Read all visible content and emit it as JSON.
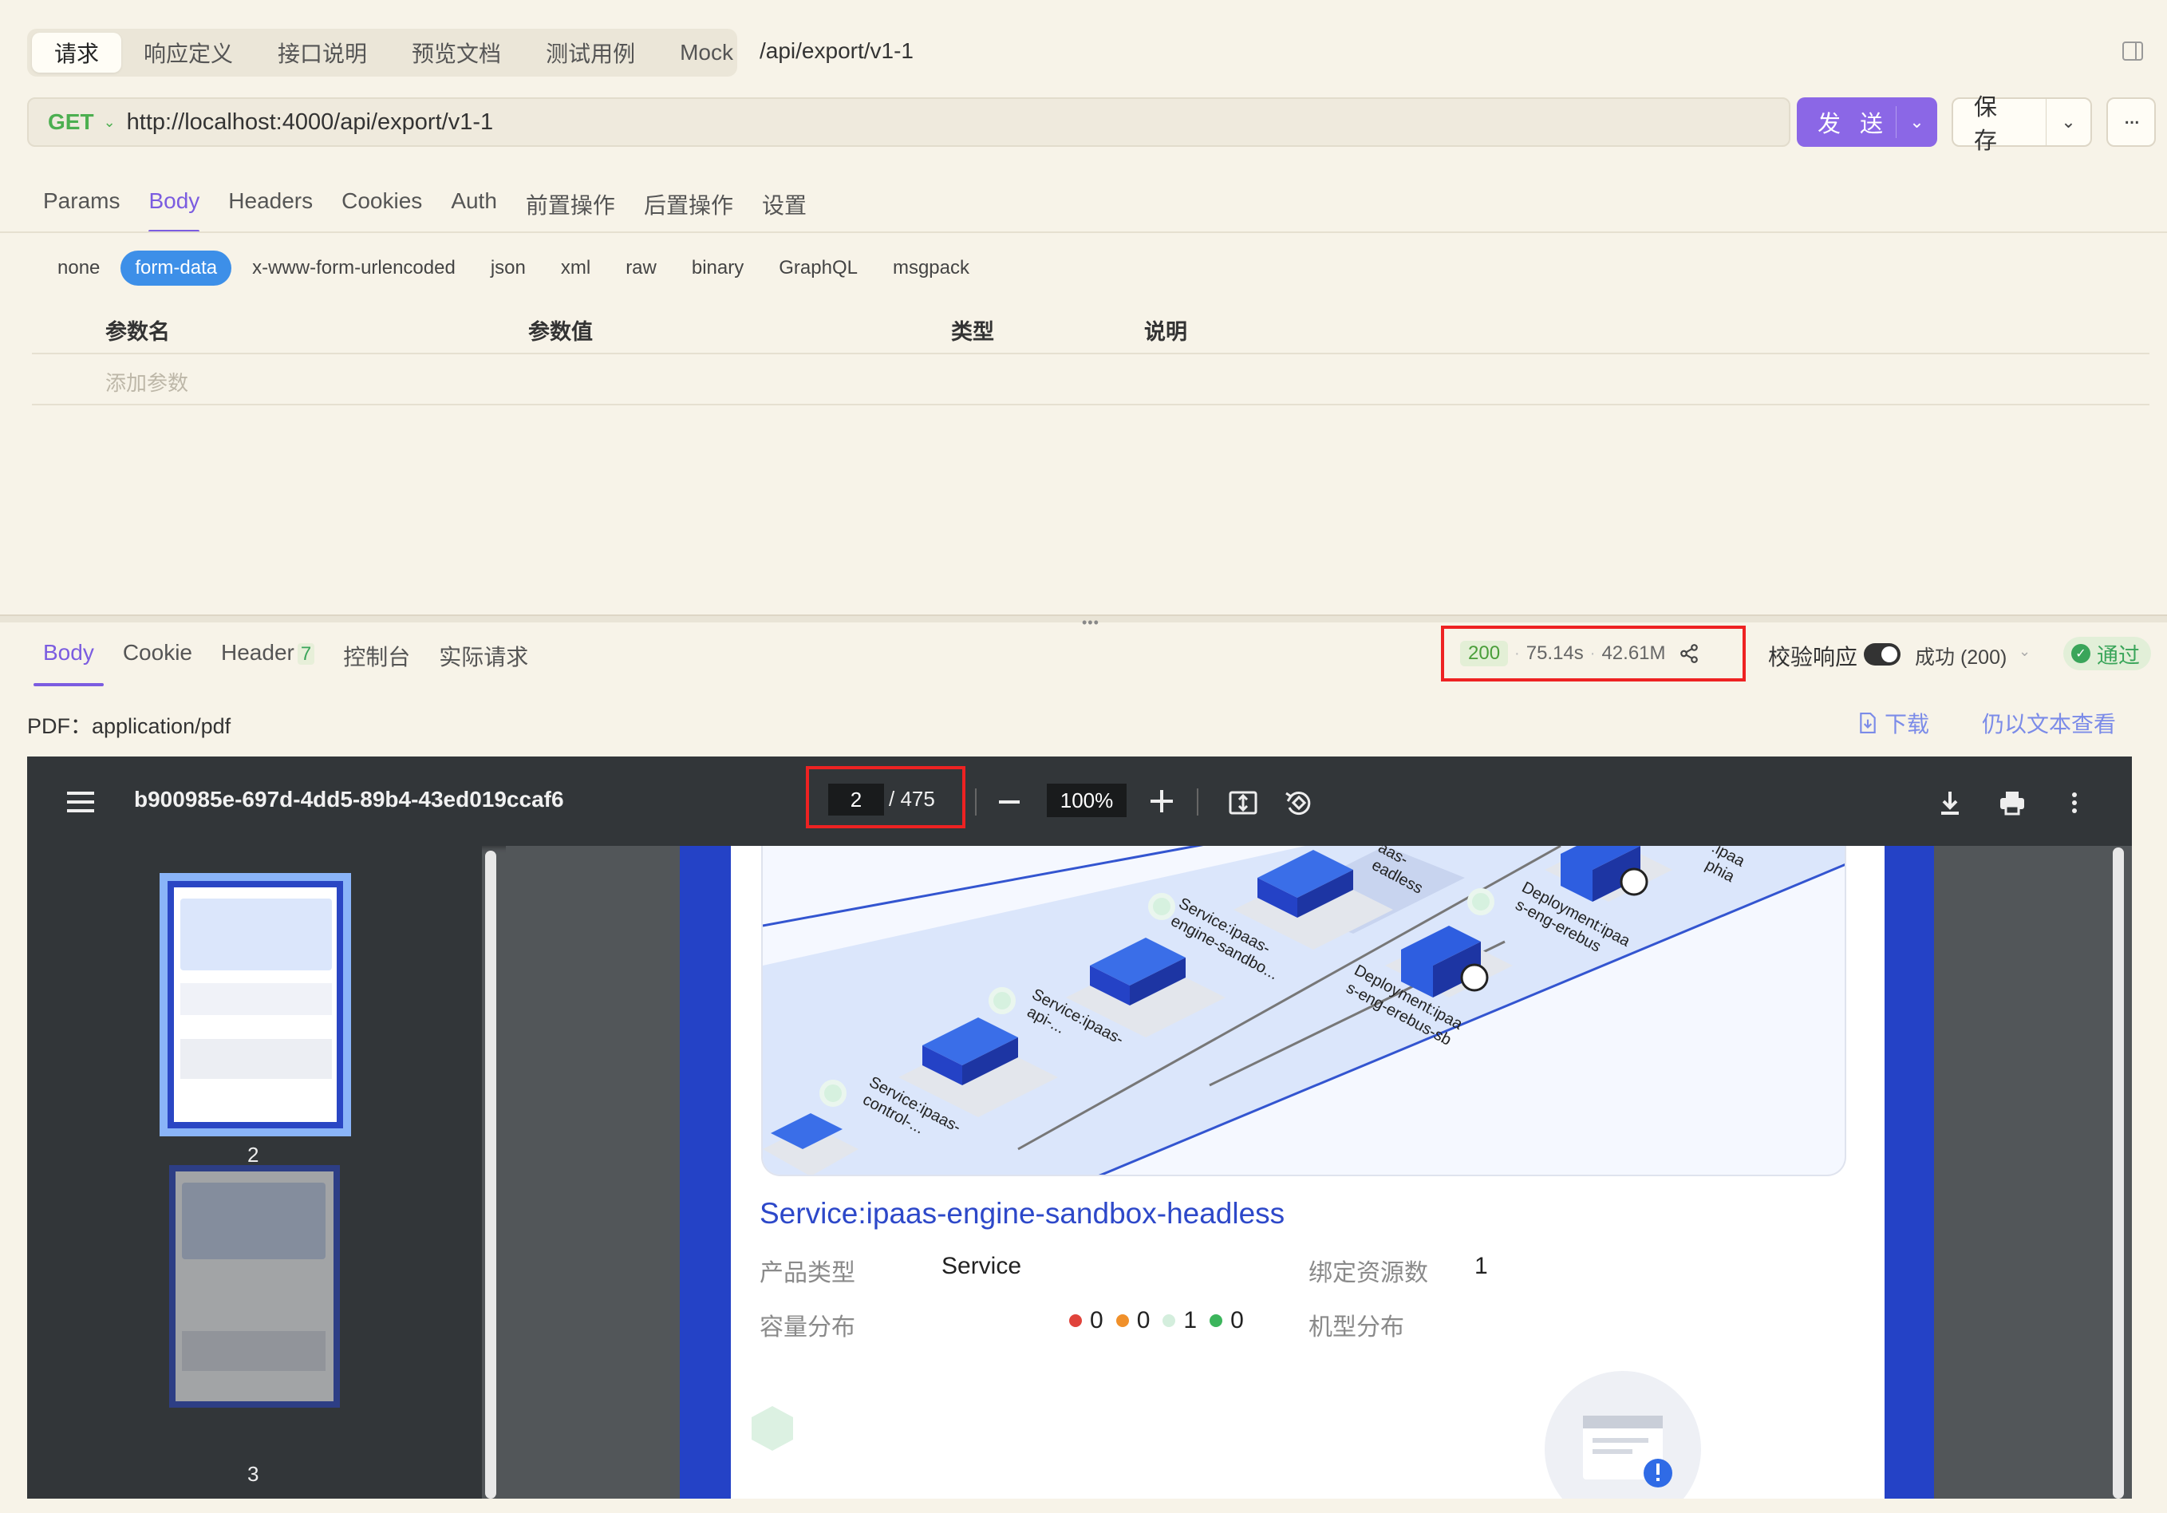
{
  "request_tabs": [
    {
      "label": "请求",
      "active": true
    },
    {
      "label": "响应定义",
      "active": false
    },
    {
      "label": "接口说明",
      "active": false
    },
    {
      "label": "预览文档",
      "active": false
    },
    {
      "label": "测试用例",
      "active": false
    },
    {
      "label": "Mock",
      "active": false
    }
  ],
  "request_path": "/api/export/v1-1",
  "url_bar": {
    "method": "GET",
    "url": "http://localhost:4000/api/export/v1-1",
    "send_label": "发 送",
    "save_label": "保 存"
  },
  "body_tabs": [
    {
      "label": "Params",
      "active": false
    },
    {
      "label": "Body",
      "active": true
    },
    {
      "label": "Headers",
      "active": false
    },
    {
      "label": "Cookies",
      "active": false
    },
    {
      "label": "Auth",
      "active": false
    },
    {
      "label": "前置操作",
      "active": false
    },
    {
      "label": "后置操作",
      "active": false
    },
    {
      "label": "设置",
      "active": false
    }
  ],
  "body_types": [
    {
      "label": "none",
      "active": false
    },
    {
      "label": "form-data",
      "active": true
    },
    {
      "label": "x-www-form-urlencoded",
      "active": false
    },
    {
      "label": "json",
      "active": false
    },
    {
      "label": "xml",
      "active": false
    },
    {
      "label": "raw",
      "active": false
    },
    {
      "label": "binary",
      "active": false
    },
    {
      "label": "GraphQL",
      "active": false
    },
    {
      "label": "msgpack",
      "active": false
    }
  ],
  "params_table": {
    "headers": [
      "参数名",
      "参数值",
      "类型",
      "说明"
    ],
    "add_placeholder": "添加参数"
  },
  "response_tabs": [
    {
      "label": "Body",
      "active": true,
      "count": ""
    },
    {
      "label": "Cookie",
      "active": false,
      "count": ""
    },
    {
      "label": "Header",
      "active": false,
      "count": "7"
    },
    {
      "label": "控制台",
      "active": false,
      "count": ""
    },
    {
      "label": "实际请求",
      "active": false,
      "count": ""
    }
  ],
  "response_stats": {
    "status": "200",
    "time": "75.14s",
    "size": "42.61M"
  },
  "validation": {
    "label": "校验响应",
    "enabled": true,
    "result": "成功 (200)",
    "badge": "通过"
  },
  "content_type": "PDF：application/pdf",
  "links": {
    "download": "下载",
    "view_as_text": "仍以文本查看"
  },
  "pdf_viewer": {
    "file_name": "b900985e-697d-4dd5-89b4-43ed019ccaf6",
    "current_page": "2",
    "total_pages": "/ 475",
    "zoom": "100%",
    "thumbnails": [
      {
        "label": "2",
        "selected": true
      },
      {
        "label": "3",
        "selected": false
      }
    ]
  },
  "pdf_page": {
    "diagram_nodes": [
      {
        "label1": "Service:ipaas-",
        "label2": "engine-sandbo..."
      },
      {
        "label1": "Service:ipaas-",
        "label2": "api-..."
      },
      {
        "label1": "Service:ipaas-",
        "label2": "control-..."
      },
      {
        "label1": "Deployment:ipaa",
        "label2": "s-eng-erebus-sb"
      },
      {
        "label1": "Deployment:ipaa",
        "label2": "s-eng-erebus"
      },
      {
        "label1": "aas-",
        "label2": "eadless"
      },
      {
        "label1": ":ipaa",
        "label2": "phia"
      }
    ],
    "service_title": "Service:ipaas-engine-sandbox-headless",
    "product_type_label": "产品类型",
    "product_type_value": "Service",
    "bound_resources_label": "绑定资源数",
    "bound_resources_value": "1",
    "capacity_label": "容量分布",
    "capacity_values": [
      {
        "color": "#e0433b",
        "value": "0"
      },
      {
        "color": "#f0902a",
        "value": "0"
      },
      {
        "color": "#d4eedd",
        "value": "1"
      },
      {
        "color": "#3cb55c",
        "value": "0"
      }
    ],
    "machine_dist_label": "机型分布"
  }
}
